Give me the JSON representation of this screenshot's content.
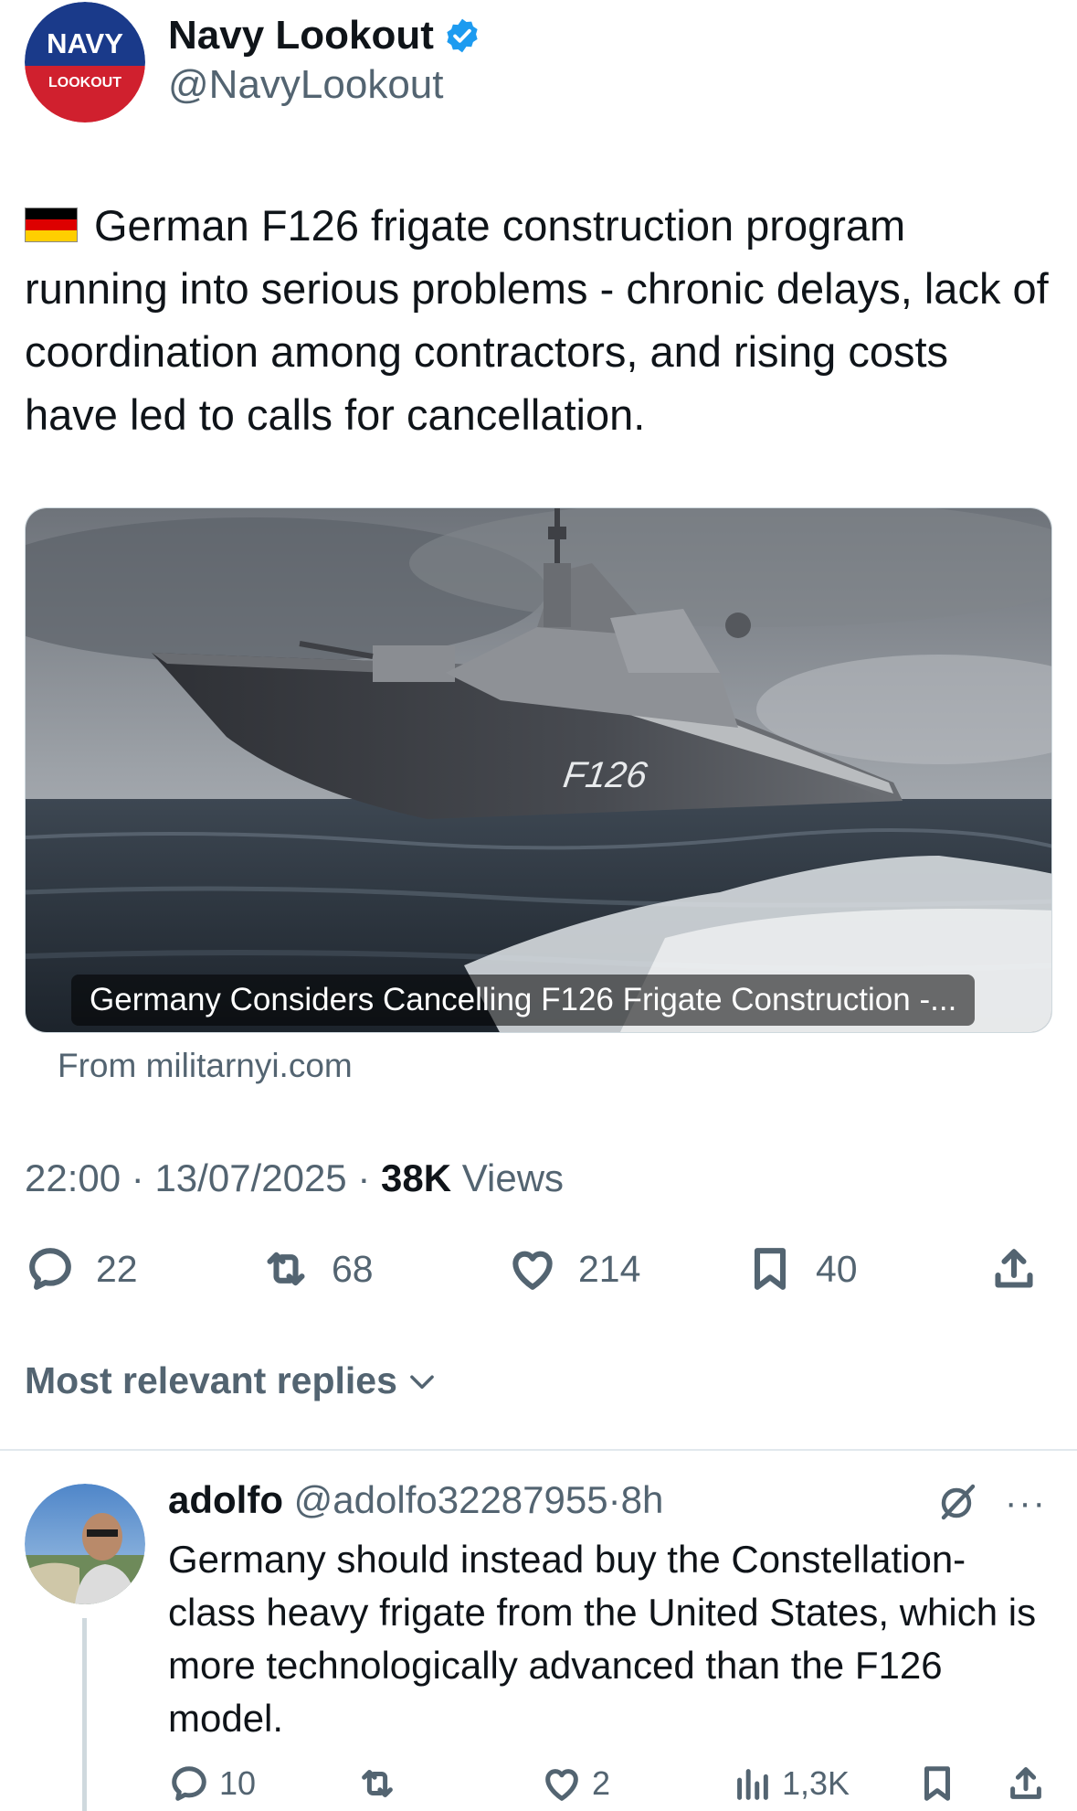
{
  "post": {
    "author": {
      "name": "Navy Lookout",
      "handle": "@NavyLookout",
      "verified": true,
      "avatar_text_top": "NAVY",
      "avatar_text_bottom": "LOOKOUT"
    },
    "flag_icon": "germany-flag",
    "text": "German F126 frigate construction program running into serious problems - chronic delays, lack of coordination among contractors, and rising costs have led to calls for cancellation.",
    "card": {
      "image_label": "F126",
      "caption": "Germany Considers Cancelling F126 Frigate Construction -...",
      "source": "From militarnyi.com"
    },
    "meta": {
      "time": "22:00",
      "date": "13/07/2025",
      "views_count": "38K",
      "views_label": "Views",
      "separator": "·"
    },
    "actions": {
      "replies": "22",
      "reposts": "68",
      "likes": "214",
      "bookmarks": "40"
    }
  },
  "replies_section": {
    "title": "Most relevant replies"
  },
  "reply": {
    "name": "adolfo",
    "handle": "@adolfo32287955",
    "separator": "·",
    "time": "8h",
    "text": "Germany should instead buy the Constellation-class heavy frigate from the United States, which is more technologically advanced than the F126 model.",
    "more": "···",
    "actions": {
      "replies": "10",
      "likes": "2",
      "views": "1,3K"
    }
  },
  "colors": {
    "text": "#0f1419",
    "secondary": "#536471",
    "verified": "#1d9bf0",
    "navy_blue": "#1a3a8a",
    "navy_red": "#d0202e"
  }
}
